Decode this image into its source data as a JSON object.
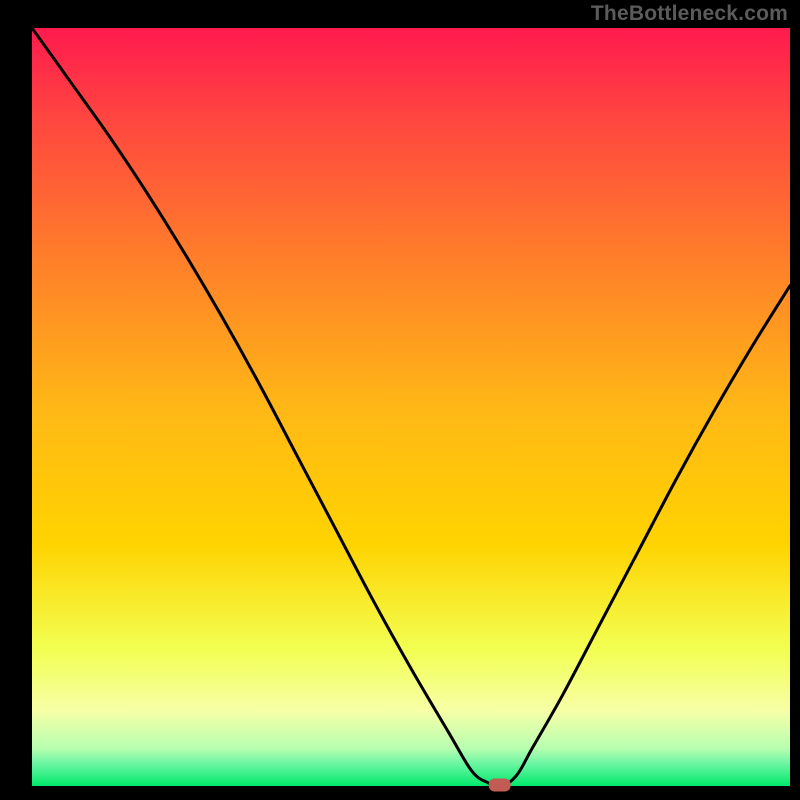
{
  "watermark": "TheBottleneck.com",
  "chart_data": {
    "type": "line",
    "title": "",
    "xlabel": "",
    "ylabel": "",
    "xlim": [
      0,
      100
    ],
    "ylim": [
      0,
      100
    ],
    "grid": false,
    "legend": false,
    "annotations": [],
    "background_gradient": {
      "top_color": "#ff1a4e",
      "mid_color": "#ffd300",
      "near_bottom_color": "#f7ffa6",
      "bottom_color": "#00e96b"
    },
    "marker": {
      "x": 61.7,
      "y": 0,
      "color": "#c15c55",
      "shape": "rounded-rect"
    },
    "series": [
      {
        "name": "bottleneck-curve",
        "x": [
          0,
          5,
          10,
          15,
          20,
          25,
          30,
          35,
          40,
          45,
          50,
          55,
          58,
          60,
          62,
          64,
          66,
          70,
          75,
          80,
          85,
          90,
          95,
          100
        ],
        "y": [
          100,
          93,
          86,
          78.5,
          70.5,
          62,
          53,
          43.5,
          34,
          24.5,
          15.5,
          7,
          2,
          0.5,
          0,
          1.5,
          5,
          12,
          21.5,
          31,
          40.5,
          49.5,
          58,
          66
        ]
      }
    ]
  }
}
